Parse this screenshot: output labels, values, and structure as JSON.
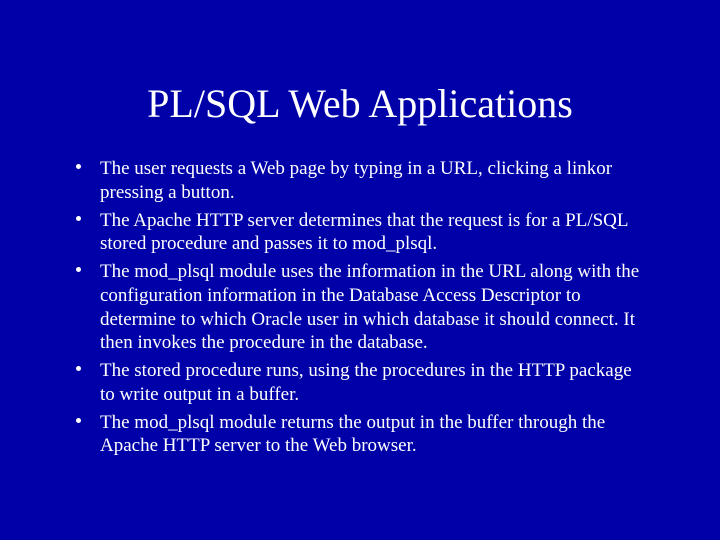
{
  "slide": {
    "title": "PL/SQL Web Applications",
    "bullets": [
      "The user requests a Web page by typing in a URL, clicking a linkor pressing a button.",
      "The Apache HTTP server determines that the request is for a PL/SQL stored procedure and passes it to mod_plsql.",
      "The mod_plsql module uses the information in the URL along with the configuration information in the Database Access Descriptor to determine to which Oracle user in which database it should connect. It then invokes the procedure in the database.",
      "The stored procedure runs, using the procedures in the HTTP package to write output in a buffer.",
      "The mod_plsql module returns the output in the buffer through the Apache HTTP server to the Web browser."
    ]
  }
}
